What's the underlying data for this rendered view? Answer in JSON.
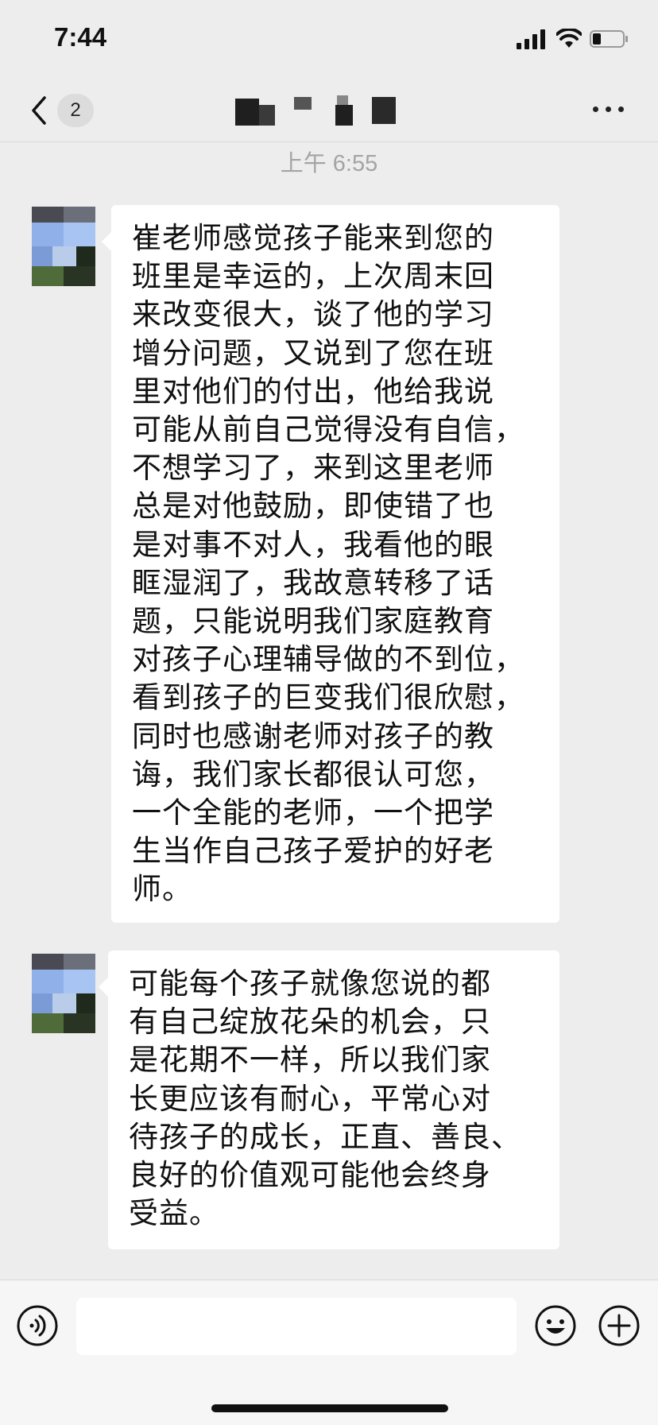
{
  "status_bar": {
    "time": "7:44",
    "icons": [
      "signal-icon",
      "wifi-icon",
      "battery-icon"
    ]
  },
  "nav": {
    "back_icon": "chevron-left-icon",
    "unread_count": "2",
    "more_icon": "more-dots-icon"
  },
  "chat": {
    "timestamp": "上午 6:55",
    "messages": [
      {
        "lines": [
          "崔老师感觉孩子能来到您的",
          "班里是幸运的，上次周末回",
          "来改变很大，谈了他的学习",
          "增分问题，又说到了您在班",
          "里对他们的付出，他给我说",
          "可能从前自己觉得没有自信，",
          "不想学习了，来到这里老师",
          "总是对他鼓励，即使错了也",
          "是对事不对人，我看他的眼",
          "眶湿润了，我故意转移了话",
          "题，只能说明我们家庭教育",
          "对孩子心理辅导做的不到位，",
          "看到孩子的巨变我们很欣慰，",
          "同时也感谢老师对孩子的教",
          "诲，我们家长都很认可您，",
          "一个全能的老师，一个把学",
          "生当作自己孩子爱护的好老",
          "师。"
        ]
      },
      {
        "lines": [
          "可能每个孩子就像您说的都",
          "有自己绽放花朵的机会，只",
          "是花期不一样，所以我们家",
          "长更应该有耐心，平常心对",
          "待孩子的成长，正直、善良、",
          "良好的价值观可能他会终身",
          "受益。"
        ]
      }
    ]
  },
  "input_bar": {
    "voice_icon": "voice-icon",
    "emoji_icon": "emoji-icon",
    "add_icon": "add-icon",
    "input_value": ""
  }
}
